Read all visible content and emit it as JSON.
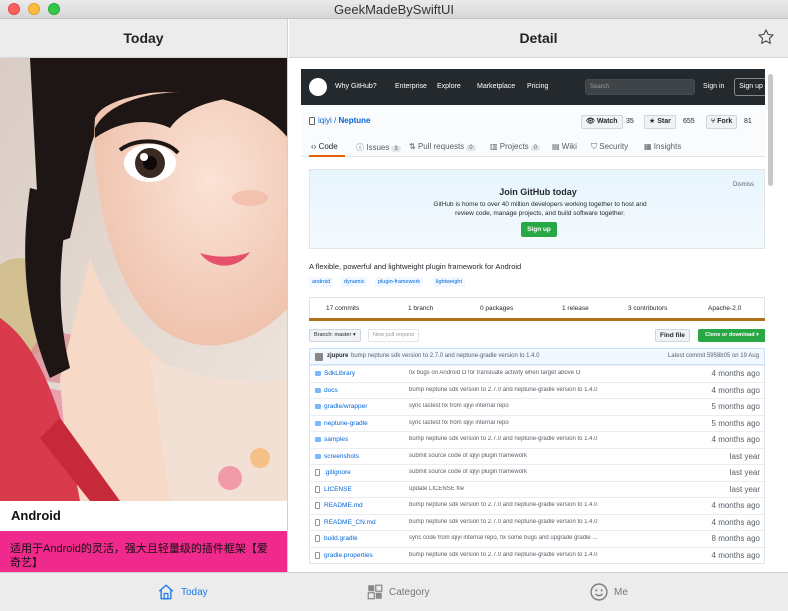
{
  "window": {
    "title": "GeekMadeBySwiftUI"
  },
  "left_panel": {
    "header": "Today",
    "card": {
      "title": "Android",
      "description": "适用于Android的灵活，强大且轻量级的插件框架【爱奇艺】"
    }
  },
  "right_panel": {
    "header": "Detail",
    "favorite_icon": "star-outline-icon",
    "web": {
      "nav": {
        "why": "Why GitHub?",
        "enterprise": "Enterprise",
        "explore": "Explore",
        "marketplace": "Marketplace",
        "pricing": "Pricing",
        "search_placeholder": "Search",
        "sign_in": "Sign in",
        "sign_up": "Sign up"
      },
      "repo": {
        "owner": "iqiyi",
        "separator": "/",
        "name": "Neptune",
        "watch_label": "Watch",
        "watch_count": "35",
        "star_label": "Star",
        "star_count": "655",
        "fork_label": "Fork",
        "fork_count": "81"
      },
      "tabs": [
        {
          "label": "Code",
          "badge": ""
        },
        {
          "label": "Issues",
          "badge": "3"
        },
        {
          "label": "Pull requests",
          "badge": "0"
        },
        {
          "label": "Projects",
          "badge": "0"
        },
        {
          "label": "Wiki",
          "badge": ""
        },
        {
          "label": "Security",
          "badge": ""
        },
        {
          "label": "Insights",
          "badge": ""
        }
      ],
      "join": {
        "title": "Join GitHub today",
        "description": "GitHub is home to over 40 million developers working together to host and review code, manage projects, and build software together.",
        "button": "Sign up",
        "dismiss": "Dismiss"
      },
      "about": "A flexible, powerful and lightweight plugin framework for Android",
      "topics": [
        "android",
        "dynamic",
        "plugin-framework",
        "lightweight"
      ],
      "stats": {
        "commits": "17 commits",
        "branches": "1 branch",
        "packages": "0 packages",
        "releases": "1 release",
        "contributors": "3 contributors",
        "license": "Apache-2.0"
      },
      "branch_button": "Branch: master ▾",
      "new_pr_button": "New pull request",
      "find_file_button": "Find file",
      "clone_button": "Clone or download ▾",
      "commit": {
        "user": "zjupure",
        "message": "bump neptune sdk version to 2.7.0 and neptune-gradle version to 1.4.0",
        "latest": "Latest commit 5958b05 on 19 Aug"
      },
      "files": [
        {
          "name": "SdkLibrary",
          "type": "dir",
          "message": "fix bugs on Android O for transluate activity when target above O",
          "age": "4 months ago"
        },
        {
          "name": "docs",
          "type": "dir",
          "message": "bump neptune sdk version to 2.7.0 and neptune-gradle version to 1.4.0",
          "age": "4 months ago"
        },
        {
          "name": "gradle/wrapper",
          "type": "dir",
          "message": "sync lastest fix from iqiyi internal repo",
          "age": "5 months ago"
        },
        {
          "name": "neptune-gradle",
          "type": "dir",
          "message": "sync lastest fix from iqiyi internal repo",
          "age": "5 months ago"
        },
        {
          "name": "samples",
          "type": "dir",
          "message": "bump neptune sdk version to 2.7.0 and neptune-gradle version to 1.4.0",
          "age": "4 months ago"
        },
        {
          "name": "screenshots",
          "type": "dir",
          "message": "submit source code of iqiyi plugin framework",
          "age": "last year"
        },
        {
          "name": ".gitignore",
          "type": "file",
          "message": "submit source code of iqiyi plugin framework",
          "age": "last year"
        },
        {
          "name": "LICENSE",
          "type": "file",
          "message": "update LICENSE file",
          "age": "last year"
        },
        {
          "name": "README.md",
          "type": "file",
          "message": "bump neptune sdk version to 2.7.0 and neptune-gradle version to 1.4.0",
          "age": "4 months ago"
        },
        {
          "name": "README_CN.md",
          "type": "file",
          "message": "bump neptune sdk version to 2.7.0 and neptune-gradle version to 1.4.0",
          "age": "4 months ago"
        },
        {
          "name": "build.gradle",
          "type": "file",
          "message": "sync code from iqiyi internal repo, fix some bugs and upgrade gradle ...",
          "age": "8 months ago"
        },
        {
          "name": "gradle.properties",
          "type": "file",
          "message": "bump neptune sdk version to 2.7.0 and neptune-gradle version to 1.4.0",
          "age": "4 months ago"
        }
      ]
    }
  },
  "tabbar": {
    "items": [
      {
        "label": "Today",
        "icon": "house-icon",
        "active": true
      },
      {
        "label": "Category",
        "icon": "grid-icon",
        "active": false
      },
      {
        "label": "Me",
        "icon": "smiley-icon",
        "active": false
      }
    ]
  },
  "colors": {
    "accent": "#1a7ae8",
    "card_desc_bg": "#f0298c",
    "github_header": "#24292e",
    "github_green": "#28a745"
  }
}
